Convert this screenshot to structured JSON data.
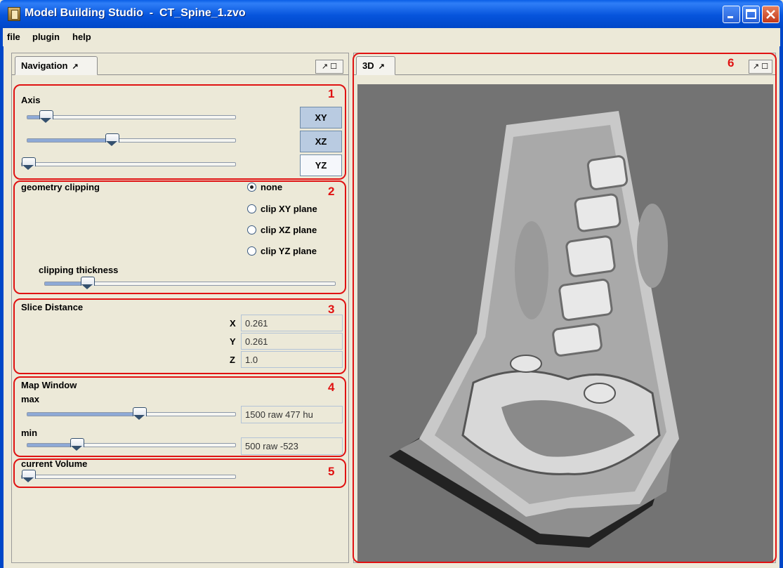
{
  "window": {
    "title": "Model Building Studio  -  CT_Spine_1.zvo",
    "controls": [
      "minimize",
      "maximize",
      "close"
    ],
    "colors": {
      "title_bar": "#0a5fe6",
      "annotation": "#e01212",
      "viewport_bg": "#737373"
    }
  },
  "menu": {
    "items": [
      "file",
      "plugin",
      "help"
    ]
  },
  "navigation_panel": {
    "tab_label": "Navigation",
    "tab_pin": "↗",
    "tab_controls": "↗ ☐",
    "axis": {
      "label": "Axis",
      "annotation": "1",
      "buttons": [
        {
          "label": "XY",
          "pressed": true
        },
        {
          "label": "XZ",
          "pressed": true
        },
        {
          "label": "YZ",
          "pressed": false
        }
      ],
      "slider_values": [
        0.06,
        0.4,
        0.0
      ]
    },
    "geometry_clipping": {
      "label": "geometry clipping",
      "annotation": "2",
      "options": [
        {
          "label": "none",
          "selected": true
        },
        {
          "label": "clip XY plane",
          "selected": false
        },
        {
          "label": "clip XZ plane",
          "selected": false
        },
        {
          "label": "clip YZ plane",
          "selected": false
        }
      ],
      "thickness_label": "clipping thickness",
      "thickness_value": 0.13
    },
    "slice_distance": {
      "label": "Slice Distance",
      "annotation": "3",
      "rows": [
        {
          "axis": "X",
          "value": "0.261"
        },
        {
          "axis": "Y",
          "value": "0.261"
        },
        {
          "axis": "Z",
          "value": "1.0"
        }
      ]
    },
    "map_window": {
      "label": "Map Window",
      "annotation": "4",
      "max_label": "max",
      "max_value": "1500 raw   477 hu",
      "max_slider": 0.54,
      "min_label": "min",
      "min_value": "500 raw   -523",
      "min_slider": 0.22
    },
    "current_volume": {
      "label": "current Volume",
      "annotation": "5",
      "slider_value": 0.0
    }
  },
  "view_panel": {
    "tab_label": "3D",
    "tab_pin": "↗",
    "tab_controls": "↗ ☐",
    "annotation": "6"
  }
}
